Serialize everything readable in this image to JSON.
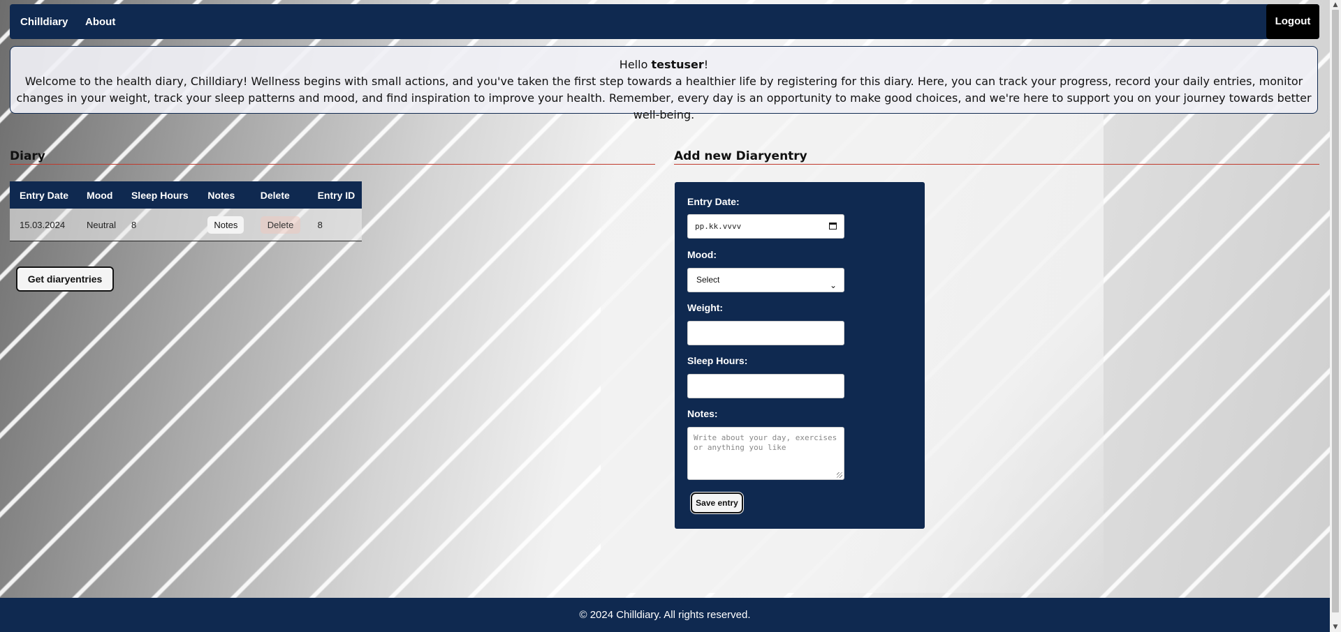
{
  "navbar": {
    "brand": "Chilldiary",
    "about": "About",
    "logout": "Logout"
  },
  "welcome": {
    "hello": "Hello ",
    "username": "testuser",
    "exclamation": "!",
    "message": "Welcome to the health diary, Chilldiary! Wellness begins with small actions, and you've taken the first step towards a healthier life by registering for this diary. Here, you can track your progress, record your daily entries, monitor changes in your weight, track your sleep patterns and mood, and find inspiration to improve your health. Remember, every day is an opportunity to make good choices, and we're here to support you on your journey towards better well-being."
  },
  "diary": {
    "title": "Diary",
    "columns": [
      "Entry Date",
      "Mood",
      "Sleep Hours",
      "Notes",
      "Delete",
      "Entry ID"
    ],
    "rows": [
      {
        "entry_date": "15.03.2024",
        "mood": "Neutral",
        "sleep_hours": "8",
        "notes_button": "Notes",
        "delete_button": "Delete",
        "entry_id": "8"
      }
    ],
    "get_button": "Get diaryentries"
  },
  "form": {
    "title": "Add new Diaryentry",
    "entry_date_label": "Entry Date:",
    "entry_date_value": "pp.kk.vvvv",
    "mood_label": "Mood:",
    "mood_selected": "Select",
    "weight_label": "Weight:",
    "weight_value": "",
    "sleep_label": "Sleep Hours:",
    "sleep_value": "",
    "notes_label": "Notes:",
    "notes_placeholder": "Write about your day, exercises or anything you like",
    "save_button": "Save entry"
  },
  "footer": {
    "text": "© 2024 Chilldiary. All rights reserved."
  },
  "colors": {
    "navy": "#0f2950",
    "accent_line": "#c0392b"
  },
  "icons": {
    "calendar": "calendar-icon",
    "dropdown": "chevron-down-icon"
  }
}
